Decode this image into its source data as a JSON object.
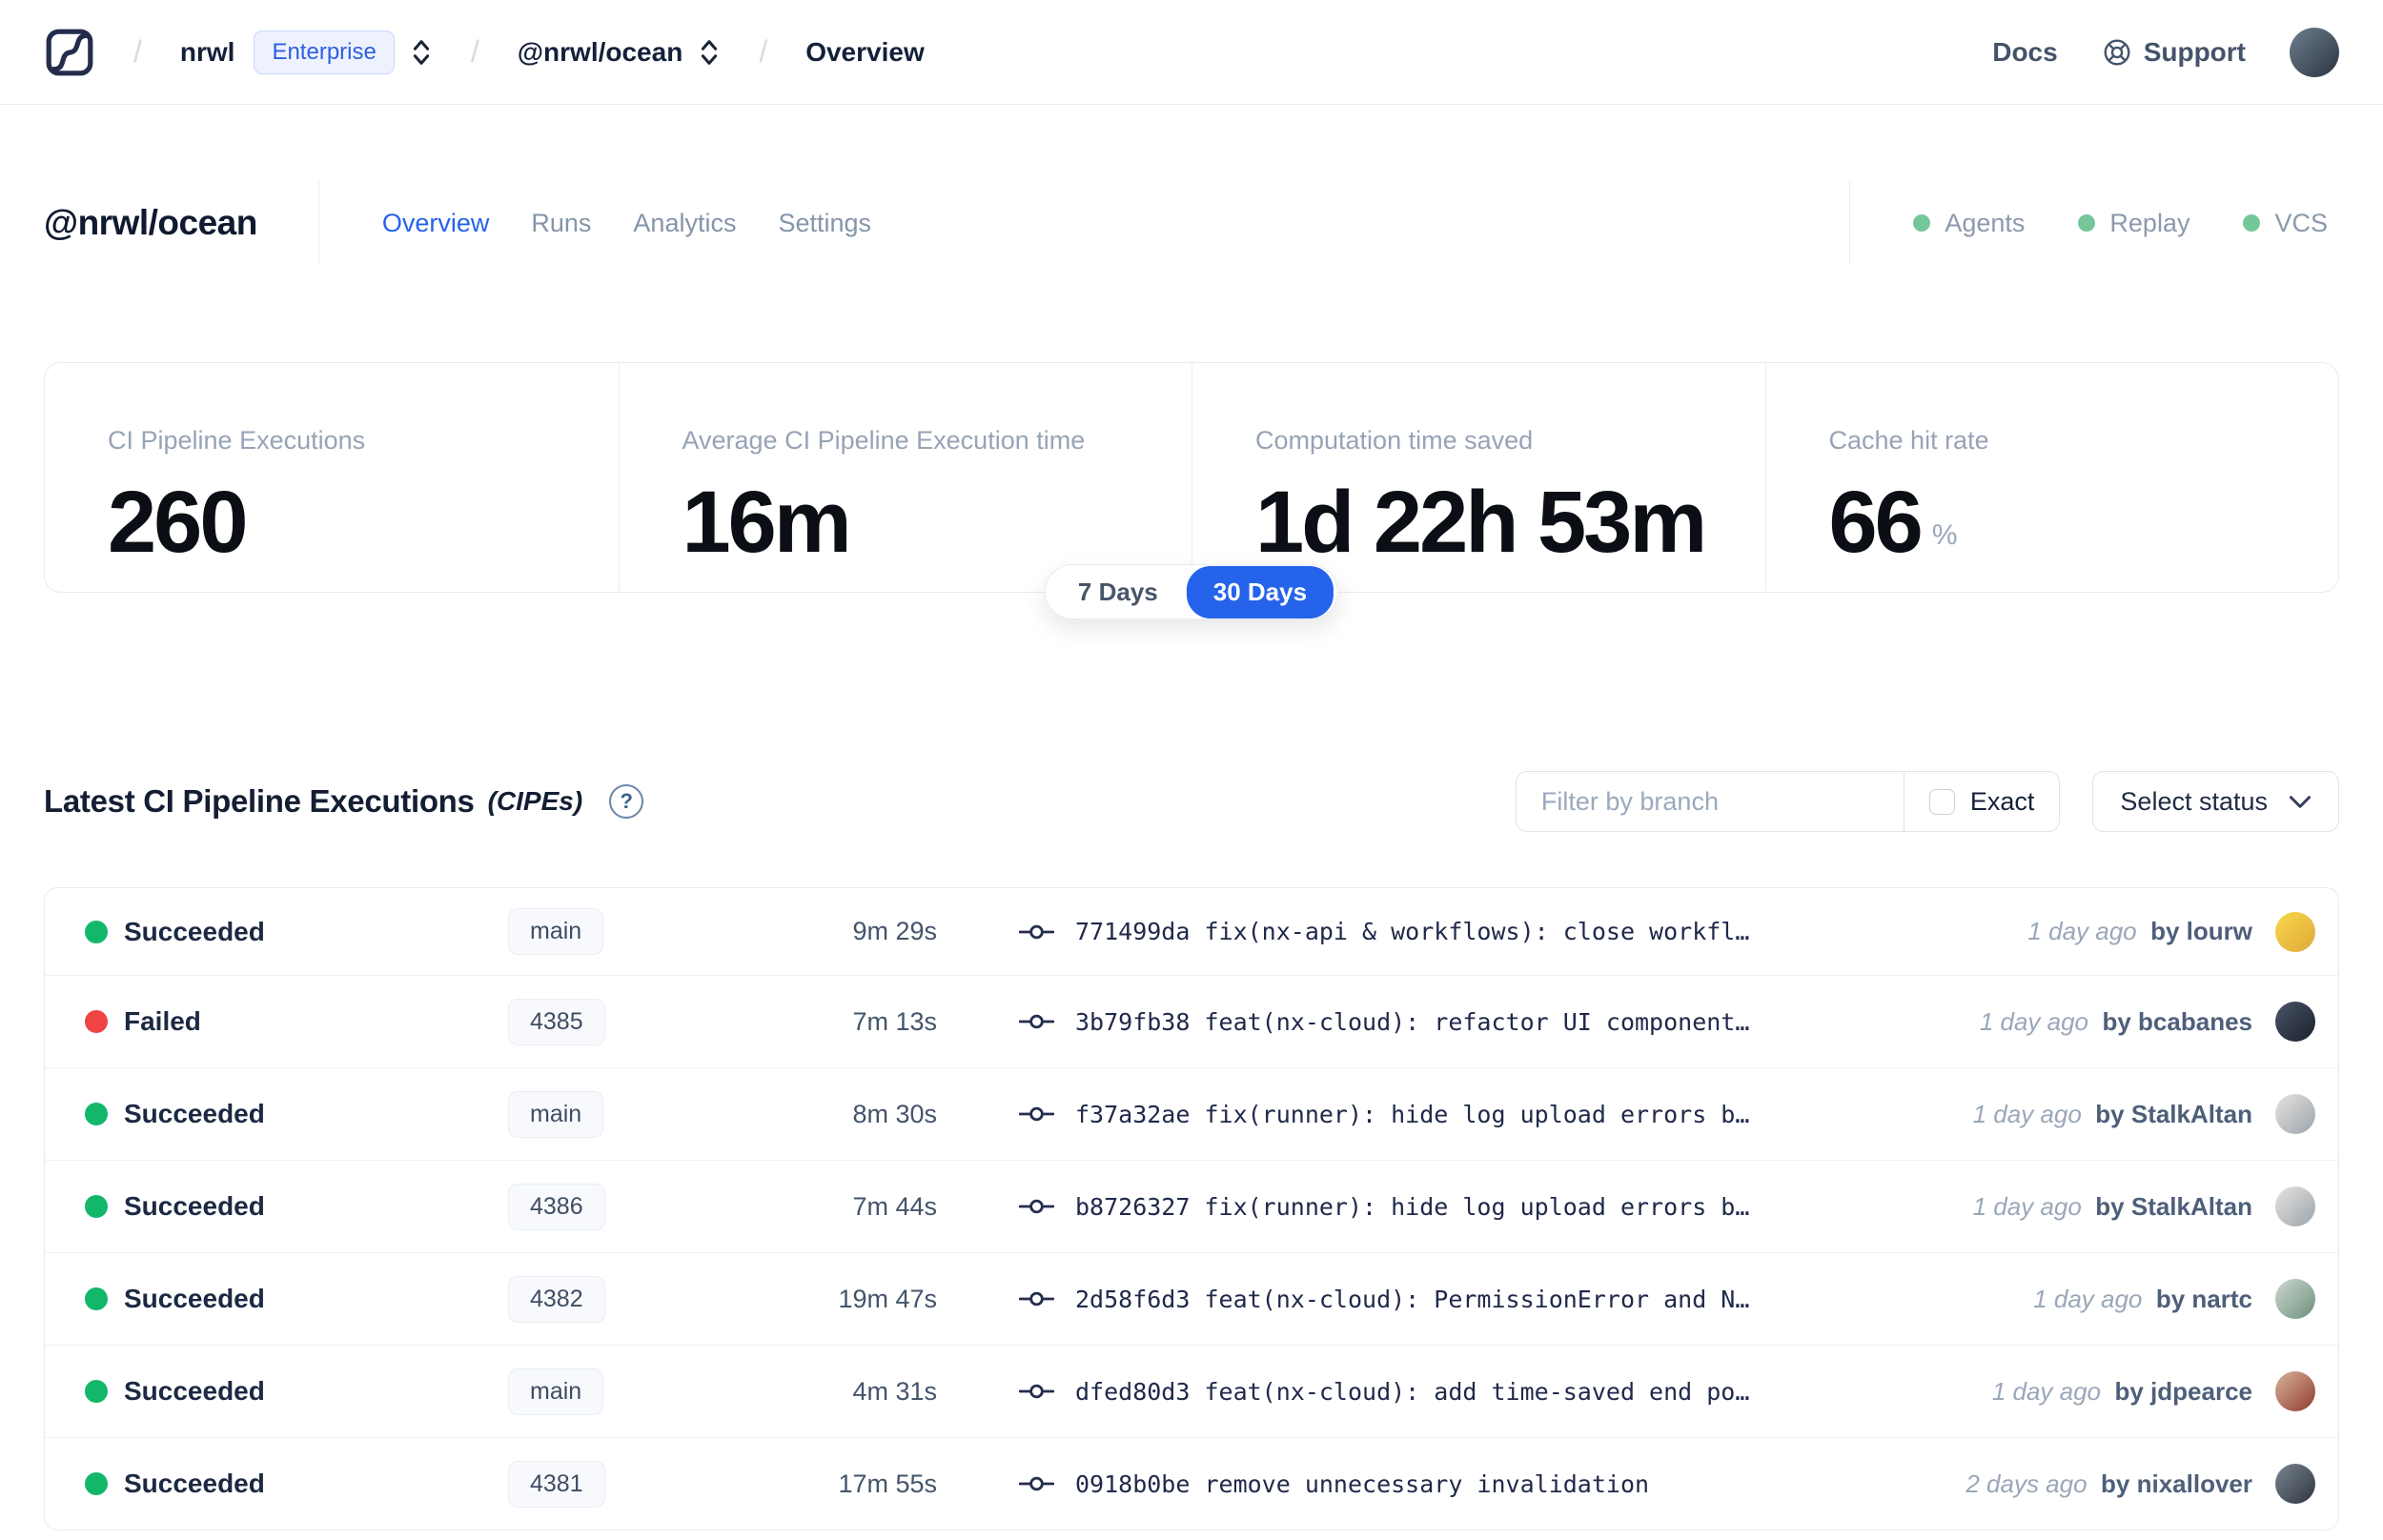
{
  "colors": {
    "accent_blue": "#2563eb",
    "succeeded_green": "#12b76a",
    "failed_red": "#ee4444",
    "badge_dot_green": "#75c79a"
  },
  "nav": {
    "separator": "/",
    "breadcrumb": {
      "org": "nrwl",
      "org_badge": "Enterprise",
      "workspace": "@nrwl/ocean",
      "page": "Overview"
    },
    "docs_label": "Docs",
    "support_label": "Support",
    "avatar": [
      "#6e7f8f",
      "#2b3440"
    ]
  },
  "header": {
    "title": "@nrwl/ocean",
    "tabs": [
      {
        "label": "Overview"
      },
      {
        "label": "Runs"
      },
      {
        "label": "Analytics"
      },
      {
        "label": "Settings"
      }
    ],
    "badges": [
      {
        "label": "Agents"
      },
      {
        "label": "Replay"
      },
      {
        "label": "VCS"
      }
    ]
  },
  "stats": {
    "cards": [
      {
        "label": "CI Pipeline Executions",
        "value": "260"
      },
      {
        "label": "Average CI Pipeline Execution time",
        "value": "16m"
      },
      {
        "label": "Computation time saved",
        "value": "1d 22h 53m"
      },
      {
        "label": "Cache hit rate",
        "value": "66",
        "suffix": "%"
      }
    ],
    "range_toggle": {
      "options": [
        "7 Days",
        "30 Days"
      ],
      "selected": "30 Days"
    }
  },
  "executions": {
    "title": "Latest CI Pipeline Executions",
    "title_suffix": "(CIPEs)",
    "help_icon": "?",
    "filter_placeholder": "Filter by branch",
    "exact_label": "Exact",
    "status_select_label": "Select status",
    "rows": [
      {
        "status": "Succeeded",
        "branch": "main",
        "duration": "9m 29s",
        "commit_sha": "771499da",
        "commit_message": "fix(nx-api & workflows): close workfl…",
        "time": "1 day ago",
        "author": "by lourw",
        "avatar": [
          "#f8d84a",
          "#dfa83a"
        ]
      },
      {
        "status": "Failed",
        "branch": "4385",
        "duration": "7m 13s",
        "commit_sha": "3b79fb38",
        "commit_message": "feat(nx-cloud): refactor UI component…",
        "time": "1 day ago",
        "author": "by bcabanes",
        "avatar": [
          "#4a5568",
          "#1a202c"
        ]
      },
      {
        "status": "Succeeded",
        "branch": "main",
        "duration": "8m 30s",
        "commit_sha": "f37a32ae",
        "commit_message": "fix(runner): hide log upload errors b…",
        "time": "1 day ago",
        "author": "by StalkAltan",
        "avatar": [
          "#e8e4de",
          "#9aa3ad"
        ]
      },
      {
        "status": "Succeeded",
        "branch": "4386",
        "duration": "7m 44s",
        "commit_sha": "b8726327",
        "commit_message": "fix(runner): hide log upload errors b…",
        "time": "1 day ago",
        "author": "by StalkAltan",
        "avatar": [
          "#e8e4de",
          "#9aa3ad"
        ]
      },
      {
        "status": "Succeeded",
        "branch": "4382",
        "duration": "19m 47s",
        "commit_sha": "2d58f6d3",
        "commit_message": "feat(nx-cloud): PermissionError and N…",
        "time": "1 day ago",
        "author": "by nartc",
        "avatar": [
          "#cfd8d2",
          "#6b8f7a"
        ]
      },
      {
        "status": "Succeeded",
        "branch": "main",
        "duration": "4m 31s",
        "commit_sha": "dfed80d3",
        "commit_message": "feat(nx-cloud): add time-saved end po…",
        "time": "1 day ago",
        "author": "by jdpearce",
        "avatar": [
          "#d8b49a",
          "#8f3b2f"
        ]
      },
      {
        "status": "Succeeded",
        "branch": "4381",
        "duration": "17m 55s",
        "commit_sha": "0918b0be",
        "commit_message": "remove unnecessary invalidation",
        "time": "2 days ago",
        "author": "by nixallover",
        "avatar": [
          "#7a8591",
          "#2e3640"
        ]
      }
    ]
  }
}
